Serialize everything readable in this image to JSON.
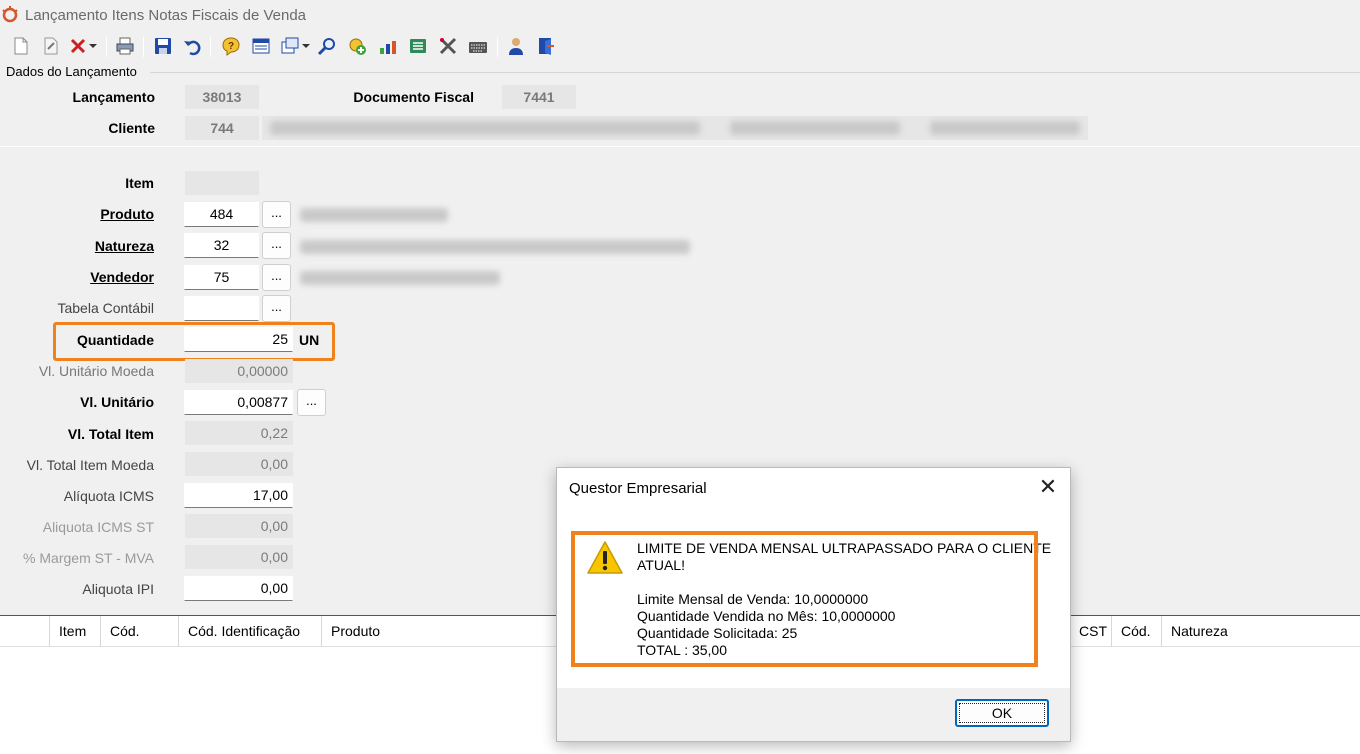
{
  "window": {
    "title": "Lançamento Itens Notas Fiscais de Venda"
  },
  "toolbar": {
    "buttons": [
      "new-icon",
      "edit-icon",
      "delete-icon",
      "dropdown-icon",
      "print-icon",
      "save-icon",
      "undo-icon",
      "help-icon",
      "table-icon",
      "window-icon",
      "search-icon",
      "add-icon",
      "chart-icon",
      "list-icon",
      "tools-icon",
      "keyboard-icon",
      "user-icon",
      "exit-icon"
    ]
  },
  "header": {
    "group_label": "Dados do Lançamento",
    "lancamento_label": "Lançamento",
    "lancamento_value": "38013",
    "documento_label": "Documento Fiscal",
    "documento_value": "7441",
    "cliente_label": "Cliente",
    "cliente_value": "744"
  },
  "form": {
    "item_label": "Item",
    "item_value": "",
    "produto_label": "Produto",
    "produto_value": "484",
    "natureza_label": "Natureza",
    "natureza_value": "32",
    "vendedor_label": "Vendedor",
    "vendedor_value": "75",
    "tabela_label": "Tabela Contábil",
    "tabela_value": "",
    "quantidade_label": "Quantidade",
    "quantidade_value": "25",
    "quantidade_unit": "UN",
    "vl_unit_moeda_label": "Vl. Unitário Moeda",
    "vl_unit_moeda_value": "0,00000",
    "vl_unit_label": "Vl. Unitário",
    "vl_unit_value": "0,00877",
    "vl_total_label": "Vl. Total Item",
    "vl_total_value": "0,22",
    "vl_total_moeda_label": "Vl. Total Item Moeda",
    "vl_total_moeda_value": "0,00",
    "icms_label": "Alíquota ICMS",
    "icms_value": "17,00",
    "icms_st_label": "Aliquota ICMS ST",
    "icms_st_value": "0,00",
    "mva_label": "% Margem ST - MVA",
    "mva_value": "0,00",
    "ipi_label": "Aliquota IPI",
    "ipi_value": "0,00",
    "dots": "..."
  },
  "grid": {
    "columns_left": [
      "Item",
      "Cód.",
      "Cód. Identificação",
      "Produto"
    ],
    "columns_right": [
      "CST",
      "Cód.",
      "Natureza"
    ]
  },
  "dialog": {
    "title": "Questor Empresarial",
    "close": "✕",
    "message_line1": "LIMITE DE VENDA MENSAL ULTRAPASSADO PARA O CLIENTE",
    "message_line2": "ATUAL!",
    "limite": "Limite Mensal de Venda: 10,0000000",
    "vendida": "Quantidade Vendida no Mês: 10,0000000",
    "solicitada": "Quantidade Solicitada: 25",
    "total": "TOTAL : 35,00",
    "ok_label": "OK"
  },
  "colors": {
    "highlight": "#f0821e",
    "focus_blue": "#0067c0"
  }
}
